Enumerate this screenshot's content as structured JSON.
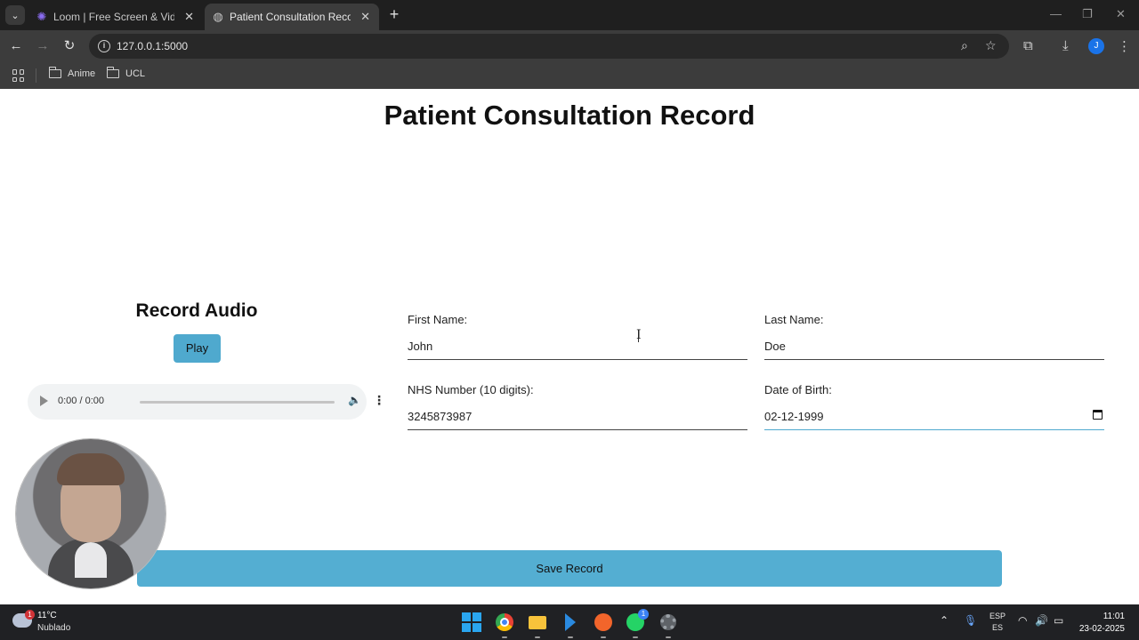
{
  "browser": {
    "tabs": [
      {
        "title": "Loom | Free Screen & Video Recording",
        "icon": "loom-icon",
        "active": false
      },
      {
        "title": "Patient Consultation Record",
        "icon": "globe-icon",
        "active": true
      }
    ],
    "url": "127.0.0.1:5000",
    "profile_initial": "J",
    "bookmarks": [
      "Anime",
      "UCL"
    ]
  },
  "page": {
    "title": "Patient Consultation Record",
    "record_audio": {
      "title": "Record Audio",
      "play_label": "Play",
      "time": "0:00 / 0:00"
    },
    "form": {
      "first_name_label": "First Name:",
      "first_name_value": "John",
      "last_name_label": "Last Name:",
      "last_name_value": "Doe",
      "nhs_label": "NHS Number (10 digits):",
      "nhs_value": "3245873987",
      "dob_label": "Date of Birth:",
      "dob_value": "02-12-1999"
    },
    "save_label": "Save Record"
  },
  "taskbar": {
    "weather_badge": "1",
    "temperature": "11°C",
    "weather_desc": "Nublado",
    "whatsapp_badge": "1",
    "lang_top": "ESP",
    "lang_bottom": "ES",
    "time": "11:01",
    "date": "23-02-2025"
  },
  "colors": {
    "accent": "#54aed2",
    "play_button": "#4fa9ce",
    "chrome_dark": "#1f1f1f",
    "chrome_toolbar": "#3c3c3c",
    "taskbar": "#202124"
  }
}
